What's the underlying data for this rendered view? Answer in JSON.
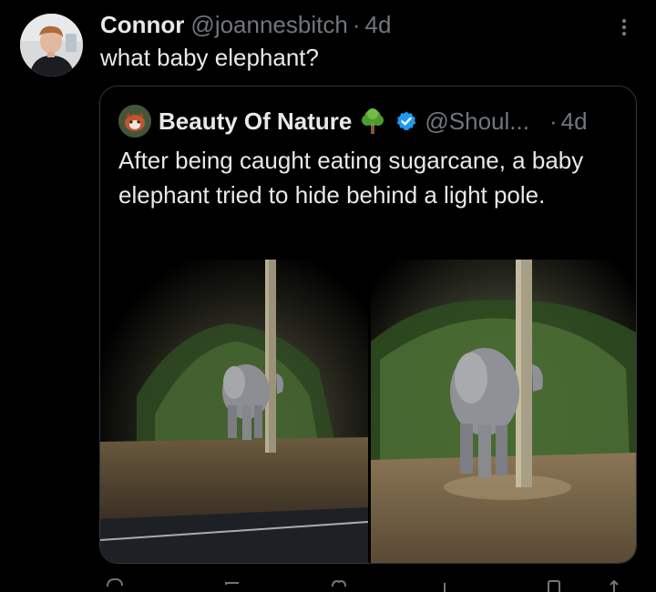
{
  "tweet": {
    "author_name": "Connor",
    "author_handle": "@joannesbitch",
    "separator": "·",
    "time": "4d",
    "text": "what baby elephant?",
    "icons": {
      "more": "more-vertical-icon",
      "avatar": "avatar-photo"
    }
  },
  "quoted_tweet": {
    "author_name": "Beauty Of Nature",
    "author_emoji": "tree-emoji-icon",
    "verified": true,
    "author_handle": "@Shoul...",
    "separator": "·",
    "time": "4d",
    "text": "After being caught eating sugarcane, a baby elephant tried to hide behind a light pole.",
    "media": [
      {
        "alt": "baby-elephant-behind-pole-photo-1"
      },
      {
        "alt": "baby-elephant-behind-pole-photo-2"
      }
    ]
  },
  "actions": [
    "reply-icon",
    "retweet-icon",
    "like-icon",
    "views-icon",
    "bookmark-icon",
    "share-icon"
  ],
  "colors": {
    "background": "#000000",
    "text_primary": "#e7e9ea",
    "text_secondary": "#71767b",
    "border": "#333639",
    "verified_blue": "#1d9bf0"
  }
}
